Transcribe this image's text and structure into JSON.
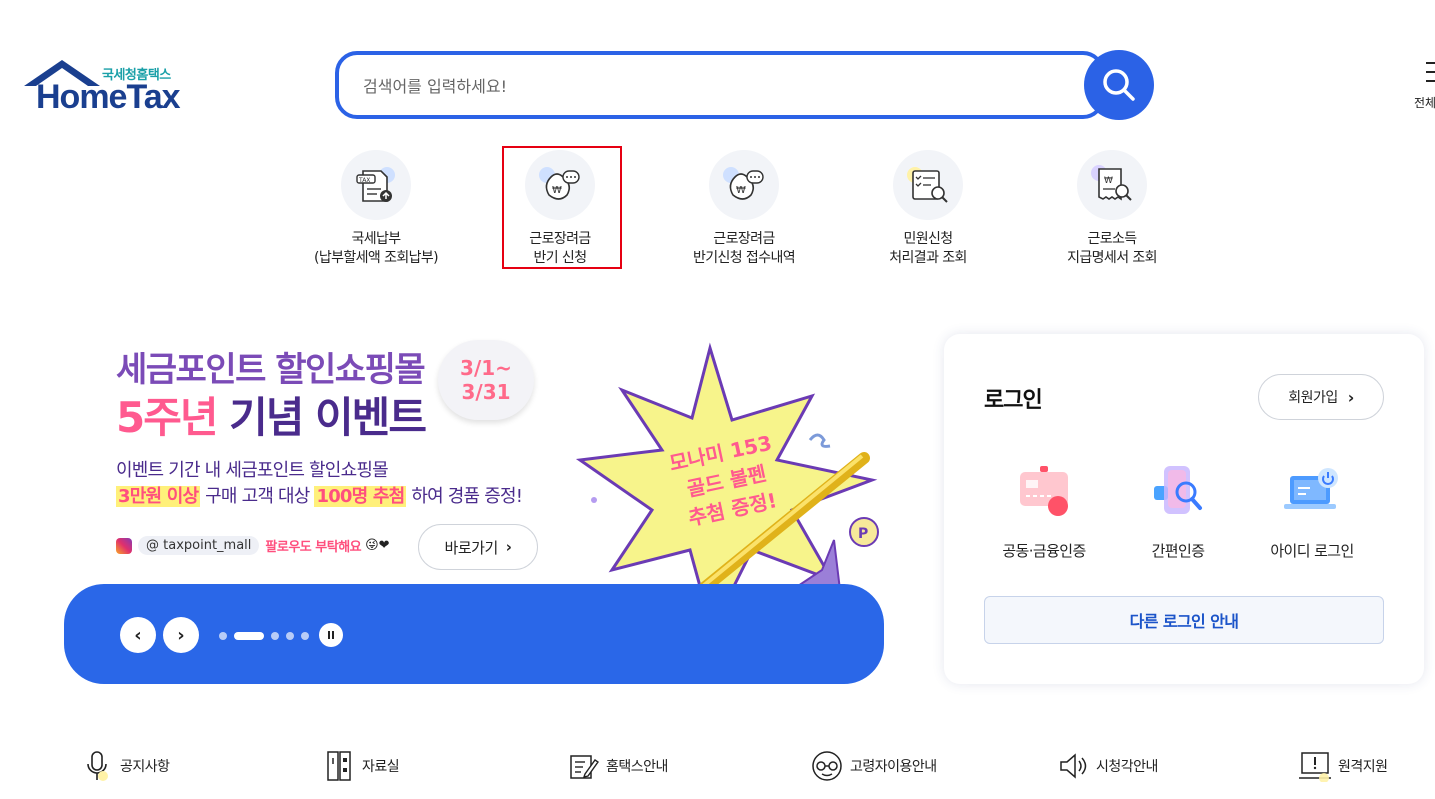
{
  "header": {
    "logo_sub": "국세청홈택스",
    "logo_main": "HomeTax",
    "search_placeholder": "검색어를 입력하세요!",
    "all_menu_label": "전체"
  },
  "quick_menu": [
    {
      "line1": "국세납부",
      "line2": "(납부할세액 조회납부)",
      "icon": "tax-upload-icon"
    },
    {
      "line1": "근로장려금",
      "line2": "반기 신청",
      "icon": "money-bag-chat-icon"
    },
    {
      "line1": "근로장려금",
      "line2": "반기신청 접수내역",
      "icon": "money-bag-chat-icon"
    },
    {
      "line1": "민원신청",
      "line2": "처리결과 조회",
      "icon": "document-search-icon"
    },
    {
      "line1": "근로소득",
      "line2": "지급명세서 조회",
      "icon": "receipt-search-icon"
    }
  ],
  "banner": {
    "title1": "세금포인트 할인쇼핑몰",
    "title2_pink": "5주년",
    "title2_rest": " 기념 이벤트",
    "date_line1": "3/1~",
    "date_line2": "3/31",
    "desc1": "이벤트 기간 내 세금포인트 할인쇼핑몰",
    "desc2_hl1": "3만원 이상",
    "desc2_mid1": " 구매 고객 대상 ",
    "desc2_hl2": "100명 추첨",
    "desc2_end": " 하여 경품 증정!",
    "insta_handle": "@ taxpoint_mall",
    "insta_follow": "팔로우도 부탁해요",
    "goto_label": "바로가기",
    "star_line1": "모나미 153",
    "star_line2": "골드 볼펜",
    "star_line3": "추첨 증정!"
  },
  "slider": {
    "prev": "‹",
    "next": "›",
    "total_slides": 6,
    "active_slide": 2
  },
  "login": {
    "title": "로그인",
    "join_label": "회원가입",
    "options": [
      {
        "label": "공동·금융인증",
        "icon": "certificate-icon"
      },
      {
        "label": "간편인증",
        "icon": "phone-search-icon"
      },
      {
        "label": "아이디 로그인",
        "icon": "laptop-power-icon"
      }
    ],
    "other_label": "다른 로그인 안내"
  },
  "bottom_links": [
    {
      "label": "공지사항",
      "icon": "microphone-icon"
    },
    {
      "label": "자료실",
      "icon": "archive-icon"
    },
    {
      "label": "홈택스안내",
      "icon": "edit-note-icon"
    },
    {
      "label": "고령자이용안내",
      "icon": "glasses-face-icon"
    },
    {
      "label": "시청각안내",
      "icon": "speaker-icon"
    },
    {
      "label": "원격지원",
      "icon": "remote-monitor-icon"
    }
  ],
  "colors": {
    "primary": "#2b62e6",
    "banner_bar": "#2a67e8",
    "highlight_border": "#e60012",
    "pink": "#ff5a8f",
    "purple": "#4a2b8c"
  }
}
